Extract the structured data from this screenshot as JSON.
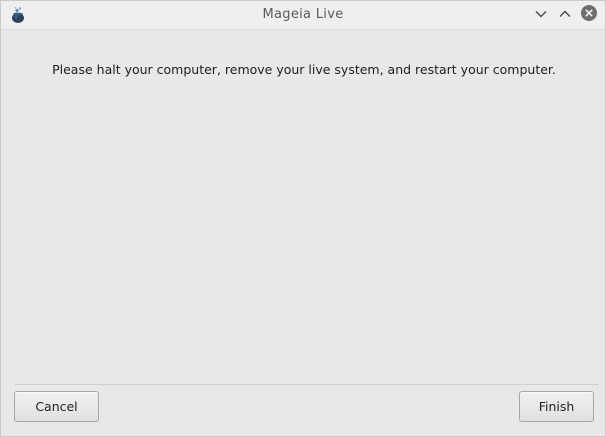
{
  "window": {
    "title": "Mageia Live",
    "app_icon": "mageia-cauldron-icon"
  },
  "controls": {
    "minimize_icon": "chevron-down-icon",
    "maximize_icon": "chevron-up-icon",
    "close_icon": "close-circle-icon"
  },
  "main": {
    "message": "Please halt your computer, remove your live system, and restart your computer."
  },
  "buttons": {
    "cancel_label": "Cancel",
    "finish_label": "Finish"
  },
  "colors": {
    "background": "#e8e8e7",
    "titlebar": "#efefee",
    "close_button": "#6e6e6e"
  }
}
